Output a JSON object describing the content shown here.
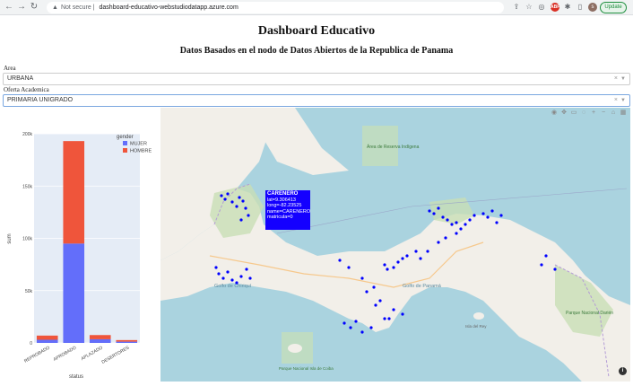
{
  "browser": {
    "security_label": "Not secure",
    "url": "dashboard-educativo-webstudiodatapp.azure.com",
    "update_label": "Update",
    "avatar_letter": "s",
    "ext_badge": "ABP"
  },
  "page": {
    "title": "Dashboard Educativo",
    "subtitle": "Datos Basados en el nodo de Datos Abiertos de la Republica de Panama"
  },
  "filters": {
    "area_label": "Area",
    "area_value": "URBANA",
    "oferta_label": "Oferta Academica",
    "oferta_value": "PRIMARIA UNIGRADO"
  },
  "chart_data": {
    "type": "bar",
    "stacked": true,
    "categories": [
      "REPROBADO",
      "APROBADO",
      "APLAZADO",
      "DESERTORES"
    ],
    "series": [
      {
        "name": "MUJER",
        "color": "#636efa",
        "values": [
          3000,
          95000,
          3500,
          1200
        ]
      },
      {
        "name": "HOMBRE",
        "color": "#ef553b",
        "values": [
          4000,
          98000,
          4000,
          1500
        ]
      }
    ],
    "xlabel": "status",
    "ylabel": "sum",
    "legend_title": "gender",
    "ylim": [
      0,
      200000
    ],
    "ytick_values": [
      0,
      50000,
      100000,
      150000,
      200000
    ],
    "ytick_labels": [
      "0",
      "50k",
      "100k",
      "150k",
      "200k"
    ],
    "grid": true,
    "legend_position": "top-right"
  },
  "map": {
    "tooltip": {
      "title": "CARENERO",
      "lines": [
        "lat=9.306413",
        "long=-82.23525",
        "name=CARENERO",
        "matricula=0"
      ]
    },
    "point_color": "#0000ff",
    "labels": [
      {
        "text": "Golfo de Panamá"
      },
      {
        "text": "Golfo de Chiriquí"
      },
      {
        "text": "Parque Nacional Darién"
      },
      {
        "text": "Área de Reserva Indígena"
      },
      {
        "text": "Isla del Rey"
      },
      {
        "text": "Parque Nacional Isla de Coiba"
      }
    ]
  }
}
